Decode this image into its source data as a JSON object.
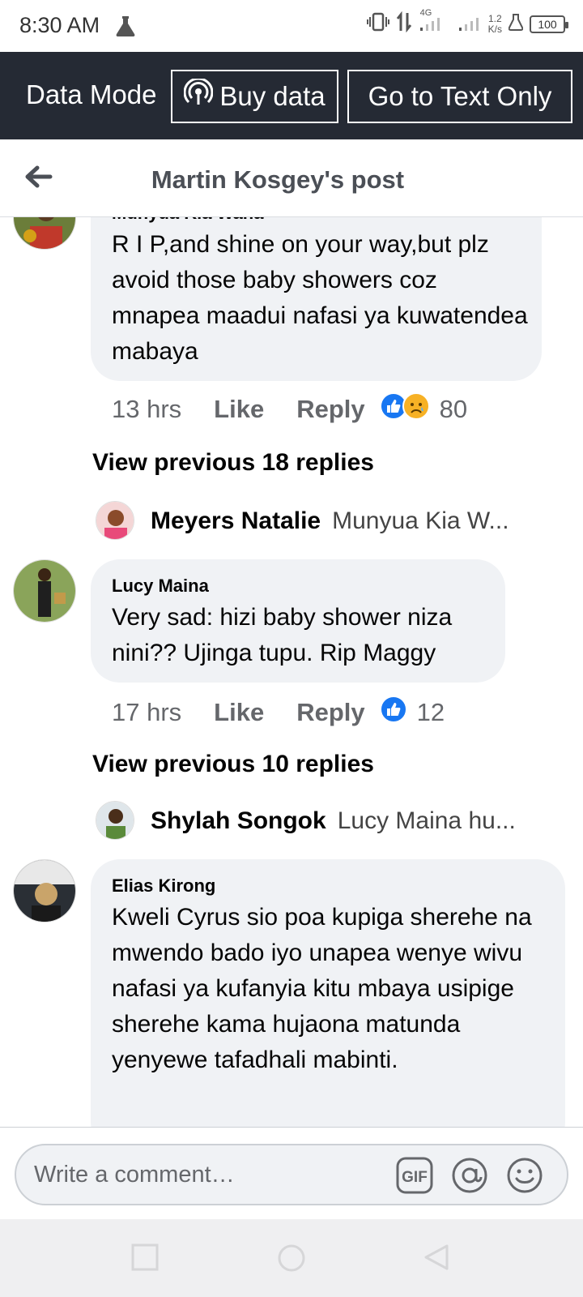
{
  "status": {
    "time": "8:30 AM",
    "network": "4G",
    "speed_value": "1.2",
    "speed_unit": "K/s",
    "battery": "100"
  },
  "databar": {
    "mode_label": "Data Mode",
    "buy_label": "Buy data",
    "text_only_label": "Go to Text Only"
  },
  "header": {
    "title": "Martin Kosgey's post"
  },
  "comments": [
    {
      "author": "Munyua Kia Wana",
      "text": "R I P,and shine on your way,but plz avoid those baby showers coz mnapea maadui nafasi ya kuwatendea mabaya",
      "time": "13 hrs",
      "like": "Like",
      "reply": "Reply",
      "reaction_count": "80",
      "view_previous": "View previous 18 replies",
      "latest_reply_author": "Meyers Natalie",
      "latest_reply_preview": "Munyua Kia W..."
    },
    {
      "author": "Lucy Maina",
      "text": "Very sad: hizi baby shower niza nini??  Ujinga tupu. Rip Maggy",
      "time": "17 hrs",
      "like": "Like",
      "reply": "Reply",
      "reaction_count": "12",
      "view_previous": "View previous 10 replies",
      "latest_reply_author": "Shylah Songok",
      "latest_reply_preview": "Lucy Maina hu..."
    },
    {
      "author": "Elias Kirong",
      "text": "Kweli Cyrus sio poa kupiga sherehe na mwendo bado iyo unapea wenye wivu nafasi ya kufanyia kitu mbaya usipige sherehe kama hujaona matunda yenyewe tafadhali mabinti."
    }
  ],
  "composer": {
    "placeholder": "Write a comment…",
    "gif_label": "GIF"
  },
  "colors": {
    "databar_bg": "#252a34",
    "like_blue": "#1877f2",
    "bubble_bg": "#f0f2f5"
  },
  "icons": [
    "flask-icon",
    "vibrate-icon",
    "data-arrows-icon",
    "signal-icon",
    "battery-icon",
    "broadcast-icon",
    "back-arrow-icon",
    "like-reaction-icon",
    "sad-reaction-icon",
    "gif-icon",
    "mention-icon",
    "emoji-icon",
    "recent-apps-icon",
    "home-icon",
    "nav-back-icon"
  ]
}
